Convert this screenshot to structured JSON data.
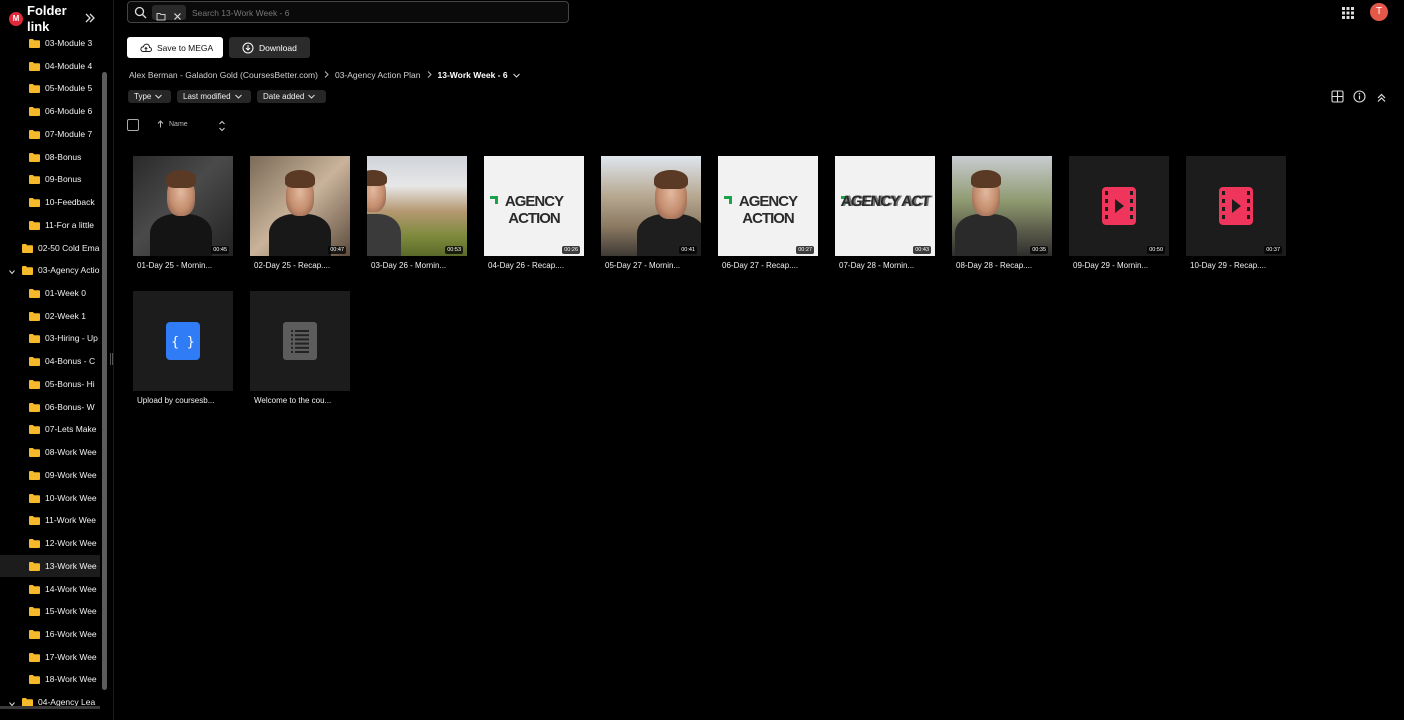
{
  "app": {
    "title": "Folder link",
    "logo_letter": "M",
    "user_initial": "T"
  },
  "search": {
    "placeholder": "Search 13-Work Week - 6"
  },
  "actions": {
    "save": "Save to MEGA",
    "download": "Download"
  },
  "breadcrumb": [
    "Alex Berman - Galadon Gold (CoursesBetter.com)",
    "03-Agency Action Plan",
    "13-Work Week - 6"
  ],
  "filters": [
    "Type",
    "Last modified",
    "Date added"
  ],
  "list_header": {
    "name": "Name"
  },
  "sidebar": {
    "items": [
      {
        "label": "03-Module 3"
      },
      {
        "label": "04-Module 4"
      },
      {
        "label": "05-Module 5"
      },
      {
        "label": "06-Module 6"
      },
      {
        "label": "07-Module 7"
      },
      {
        "label": "08-Bonus"
      },
      {
        "label": "09-Bonus"
      },
      {
        "label": "10-Feedback"
      },
      {
        "label": "11-For a little"
      },
      {
        "label": "02-50 Cold Ema"
      },
      {
        "label": "03-Agency Actio"
      },
      {
        "label": "01-Week 0"
      },
      {
        "label": "02-Week 1"
      },
      {
        "label": "03-Hiring - Up"
      },
      {
        "label": "04-Bonus - C"
      },
      {
        "label": "05-Bonus- Hi"
      },
      {
        "label": "06-Bonus- W"
      },
      {
        "label": "07-Lets Make"
      },
      {
        "label": "08-Work Wee"
      },
      {
        "label": "09-Work Wee"
      },
      {
        "label": "10-Work Wee"
      },
      {
        "label": "11-Work Wee"
      },
      {
        "label": "12-Work Wee"
      },
      {
        "label": "13-Work Wee"
      },
      {
        "label": "14-Work Wee"
      },
      {
        "label": "15-Work Wee"
      },
      {
        "label": "16-Work Wee"
      },
      {
        "label": "17-Work Wee"
      },
      {
        "label": "18-Work Wee"
      },
      {
        "label": "04-Agency Lea"
      }
    ]
  },
  "files": [
    {
      "name": "01-Day 25 - Mornin...",
      "duration": "00:45",
      "thumb": "face"
    },
    {
      "name": "02-Day 25 - Recap....",
      "duration": "00:47",
      "thumb": "face2"
    },
    {
      "name": "03-Day 26 - Mornin...",
      "duration": "00:53",
      "thumb": "fence"
    },
    {
      "name": "04-Day 26 - Recap....",
      "duration": "00:26",
      "thumb": "logo",
      "logo_text": "AGENCY ACTION"
    },
    {
      "name": "05-Day 27 - Mornin...",
      "duration": "00:41",
      "thumb": "street"
    },
    {
      "name": "06-Day 27 - Recap....",
      "duration": "00:27",
      "thumb": "logo",
      "logo_text": "AGENCY ACTION"
    },
    {
      "name": "07-Day 28 - Mornin...",
      "duration": "00:43",
      "thumb": "logo-glitch",
      "logo_text": "AGENCY ACT"
    },
    {
      "name": "08-Day 28 - Recap....",
      "duration": "00:35",
      "thumb": "park"
    },
    {
      "name": "09-Day 29 - Mornin...",
      "duration": "00:50",
      "thumb": "video-icon"
    },
    {
      "name": "10-Day 29 - Recap....",
      "duration": "00:37",
      "thumb": "video-icon"
    },
    {
      "name": "Upload by coursesb...",
      "thumb": "code-icon"
    },
    {
      "name": "Welcome to the cou...",
      "thumb": "text-icon"
    }
  ],
  "colors": {
    "folder": "#f5b92b",
    "video_icon": "#f0355d",
    "code_icon": "#2f7cf6",
    "text_icon": "#5c5c5c",
    "agency_green": "#1aa34a"
  }
}
